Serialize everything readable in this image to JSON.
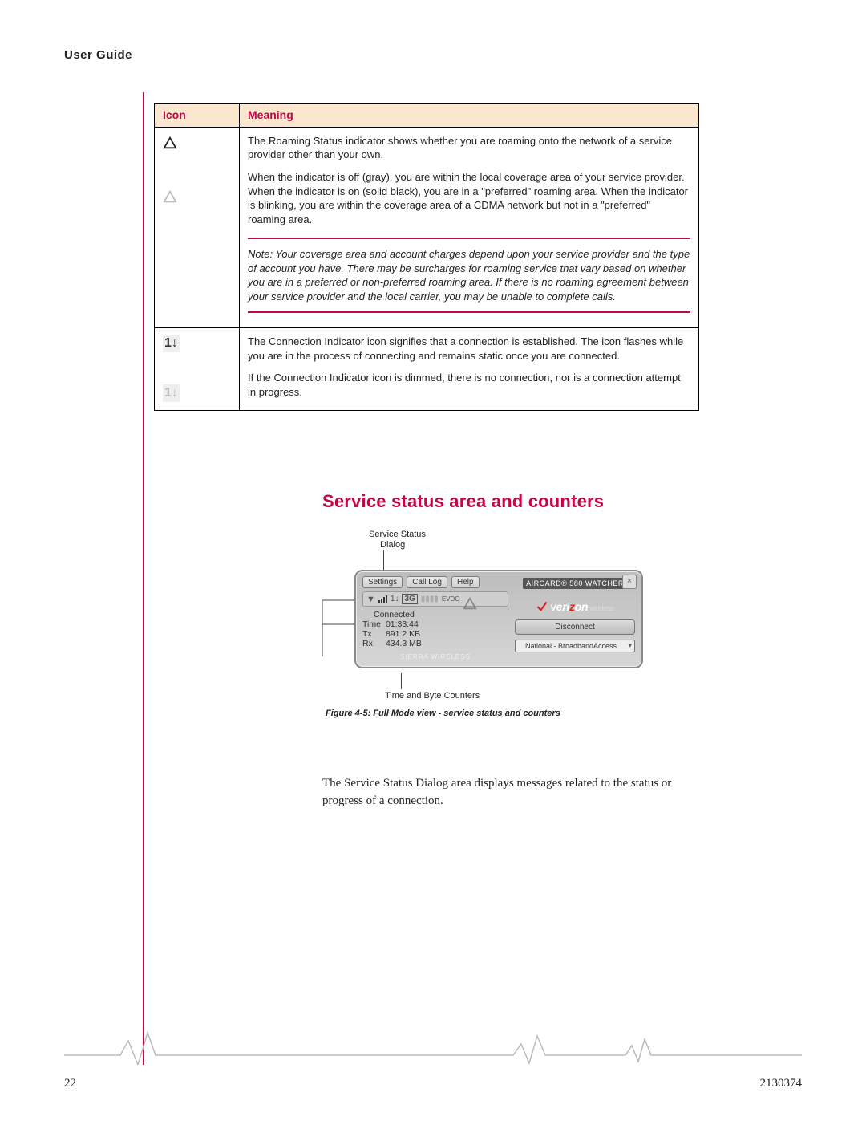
{
  "running_head": "User Guide",
  "table": {
    "head_icon": "Icon",
    "head_meaning": "Meaning",
    "row1": {
      "p1": "The Roaming Status indicator shows whether you are roaming onto the network of a service provider other than your own.",
      "p2": "When the indicator is off (gray), you are within the local coverage area of your service provider. When the indicator is on (solid black), you are in a \"preferred\" roaming area. When the indicator is blinking, you are within the coverage area of a CDMA network but not in a \"preferred\" roaming area.",
      "note": "Note:  Your coverage area and account charges depend upon your service provider and the type of account you have. There may be surcharges for roaming service that vary based on whether you are in a preferred or non-preferred roaming area. If there is no roaming agreement between your service provider and the local carrier, you may be unable to complete calls."
    },
    "row2": {
      "p1": "The Connection Indicator icon signifies that a connection is established. The icon flashes while you are in the process of connecting and remains static once you are connected.",
      "p2": "If the Connection Indicator icon is dimmed, there is no connection, nor is a connection attempt in progress."
    }
  },
  "heading": "Service status area and counters",
  "figure": {
    "callout_top_l1": "Service Status",
    "callout_top_l2": "Dialog",
    "callout_bot": "Time and Byte Counters",
    "caption": "Figure 4-5: Full Mode view - service status and counters"
  },
  "watcher": {
    "btn_settings": "Settings",
    "btn_calllog": "Call Log",
    "btn_help": "Help",
    "badge": "AIRCARD® 580 WATCHER",
    "icons_3g": "3G",
    "icons_evdo": "EVDO",
    "status_connected": "Connected",
    "lbl_time": "Time",
    "val_time": "01:33:44",
    "lbl_tx": "Tx",
    "val_tx": "891.2 KB",
    "lbl_rx": "Rx",
    "val_rx": "434.3 MB",
    "logo_pre": "veri",
    "logo_z": "z",
    "logo_post": "on",
    "logo_sub": "wireless",
    "btn_disconnect": "Disconnect",
    "dropdown": "National - BroadbandAccess",
    "sierra": "SIERRA WIRELESS"
  },
  "body_para": "The Service Status Dialog area displays messages related to the status or progress of a connection.",
  "footer_page": "22",
  "footer_doc": "2130374"
}
